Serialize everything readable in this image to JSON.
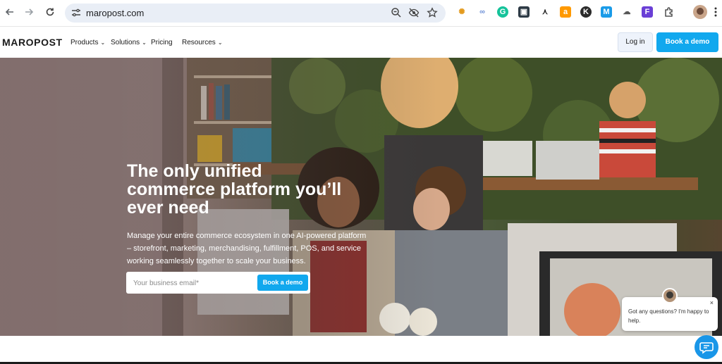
{
  "browser": {
    "url": "maropost.com",
    "back_icon": "arrow-left-icon",
    "forward_icon": "arrow-right-icon",
    "reload_icon": "reload-icon",
    "extensions": [
      {
        "name": "extension-sun-icon",
        "color": "#e39a1d",
        "glyph": "✺"
      },
      {
        "name": "extension-link-icon",
        "color": "#6c8fd6",
        "glyph": "∞"
      },
      {
        "name": "extension-grammarly-icon",
        "color": "#15c39a",
        "glyph": "G"
      },
      {
        "name": "extension-clapper-icon",
        "color": "#2d3a45",
        "glyph": "▣"
      },
      {
        "name": "extension-figure-icon",
        "color": "#ffffff",
        "glyph": "⋏"
      },
      {
        "name": "extension-amazon-icon",
        "color": "#ff9900",
        "glyph": "a"
      },
      {
        "name": "extension-k-icon",
        "color": "#2b2b2b",
        "glyph": "K"
      },
      {
        "name": "extension-m-icon",
        "color": "#1a9be8",
        "glyph": "M"
      },
      {
        "name": "extension-cloud-icon",
        "color": "#ffffff",
        "glyph": "☁"
      },
      {
        "name": "extension-form-icon",
        "color": "#6a3fd6",
        "glyph": "F"
      },
      {
        "name": "extension-puzzle-icon",
        "color": "#ffffff",
        "glyph": "⧉"
      }
    ]
  },
  "header": {
    "logo": "MAROPOST",
    "menu": [
      {
        "label": "Products",
        "has_dropdown": true
      },
      {
        "label": "Solutions",
        "has_dropdown": true
      },
      {
        "label": "Pricing",
        "has_dropdown": false
      },
      {
        "label": "Resources",
        "has_dropdown": true
      }
    ],
    "login_label": "Log in",
    "demo_label": "Book a demo"
  },
  "hero": {
    "title_line1": "The only unified",
    "title_line2": "commerce platform you’ll",
    "title_line3": "ever need",
    "subtitle": "Manage your entire commerce ecosystem in one AI-powered platform – storefront, marketing, merchandising, fulfillment, POS, and service working seamlessly together to scale your business.",
    "email_placeholder": "Your business email*",
    "cta_label": "Book a demo"
  },
  "chat": {
    "message": "Got any questions? I'm happy to help.",
    "close_glyph": "×"
  },
  "colors": {
    "accent": "#11a8ee",
    "chat_fab": "#1996e8"
  }
}
